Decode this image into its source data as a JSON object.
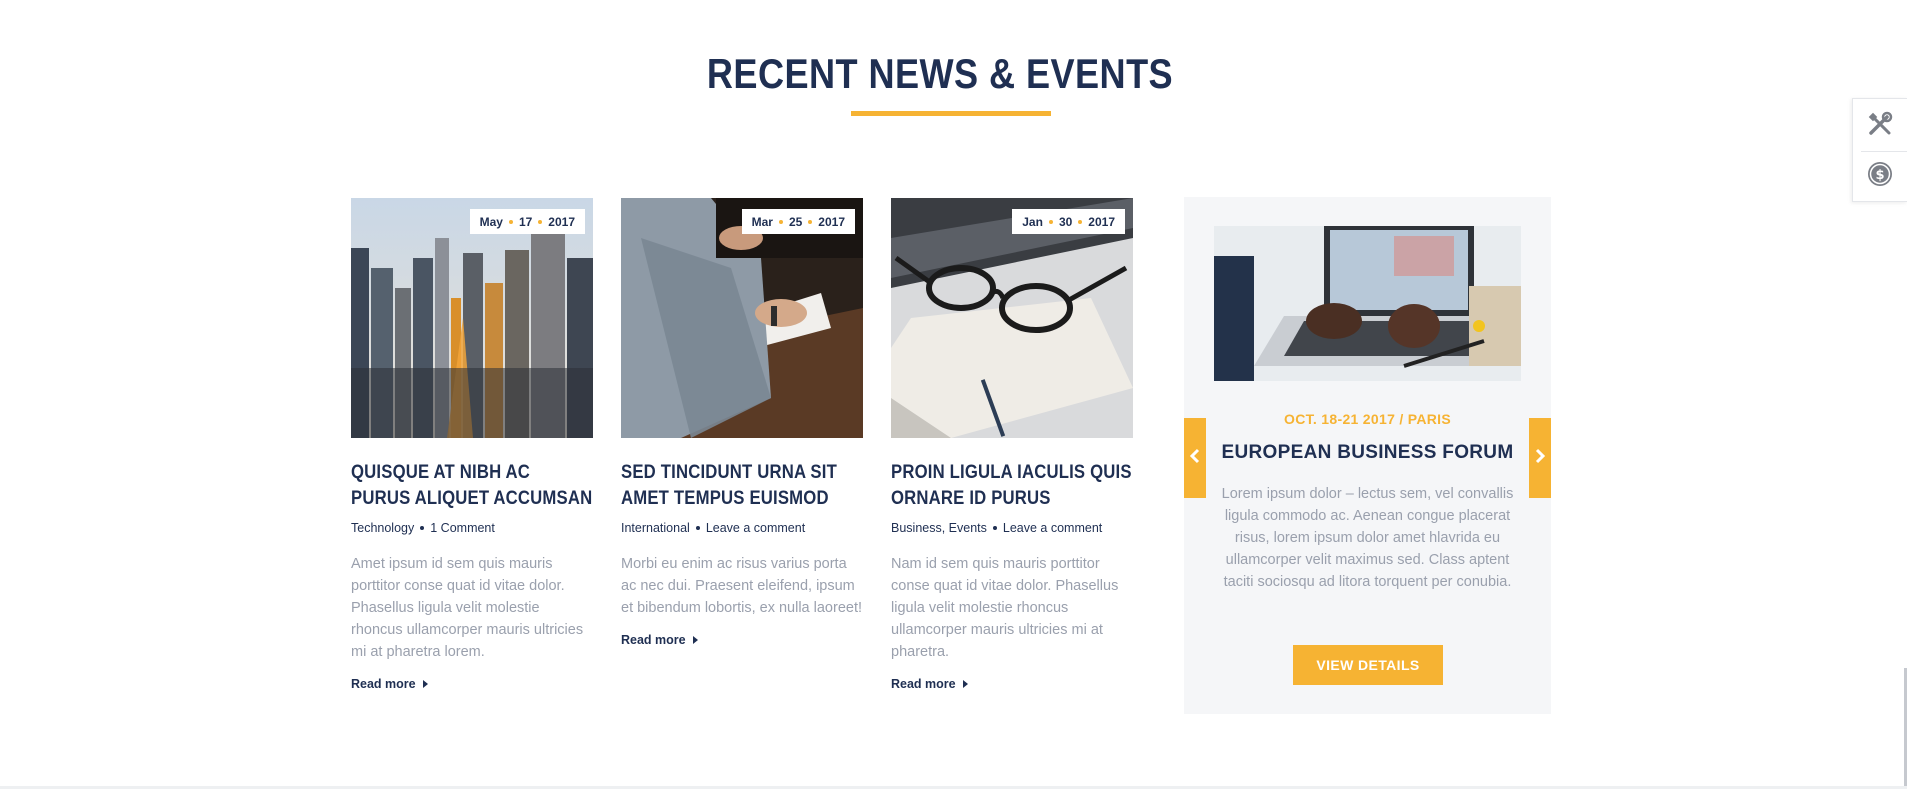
{
  "section": {
    "title": "RECENT NEWS & EVENTS"
  },
  "posts": [
    {
      "date": {
        "month": "May",
        "day": "17",
        "year": "2017"
      },
      "title": "QUISQUE AT NIBH AC PURUS ALIQUET ACCUMSAN",
      "category": "Technology",
      "comments": "1 Comment",
      "excerpt": "Amet ipsum id sem quis mauris porttitor conse quat id vitae dolor. Phasellus ligula velit molestie rhoncus ullamcorper mauris ultricies mi at pharetra lorem.",
      "read_more": "Read more",
      "image_icon": "city-skyline-photo"
    },
    {
      "date": {
        "month": "Mar",
        "day": "25",
        "year": "2017"
      },
      "title": "SED TINCIDUNT URNA SIT AMET TEMPUS EUISMOD",
      "category": "International",
      "comments": "Leave a comment",
      "excerpt": "Morbi eu enim ac risus varius porta ac nec dui. Praesent eleifend, ipsum et bibendum lobortis, ex nulla laoreet!",
      "read_more": "Read more",
      "image_icon": "writing-desk-photo"
    },
    {
      "date": {
        "month": "Jan",
        "day": "30",
        "year": "2017"
      },
      "title": "PROIN LIGULA IACULIS QUIS ORNARE ID PURUS",
      "category": "Business, Events",
      "comments": "Leave a comment",
      "excerpt": "Nam id sem quis mauris porttitor conse quat id vitae dolor. Phasellus ligula velit molestie rhoncus ullamcorper mauris ultricies mi at pharetra.",
      "read_more": "Read more",
      "image_icon": "glasses-notebook-photo"
    }
  ],
  "event": {
    "date_location": "OCT. 18-21 2017 / PARIS",
    "title": "EUROPEAN BUSINESS FORUM",
    "description": "Lorem ipsum dolor –  lectus sem, vel convallis ligula commodo ac. Aenean congue placerat risus, lorem ipsum dolor amet hlavrida eu ullamcorper velit maximus sed. Class aptent taciti sociosqu ad litora torquent per conubia.",
    "button_label": "VIEW DETAILS",
    "image_icon": "laptop-typing-photo",
    "prev_icon": "chevron-left-icon",
    "next_icon": "chevron-right-icon"
  },
  "tool_panel": {
    "tools_icon": "tools-icon",
    "dollar_icon": "dollar-circle-icon"
  },
  "colors": {
    "navy": "#1f2f52",
    "accent": "#f6b333",
    "muted_text": "#9aa0ad",
    "event_bg": "#f5f6f8"
  }
}
